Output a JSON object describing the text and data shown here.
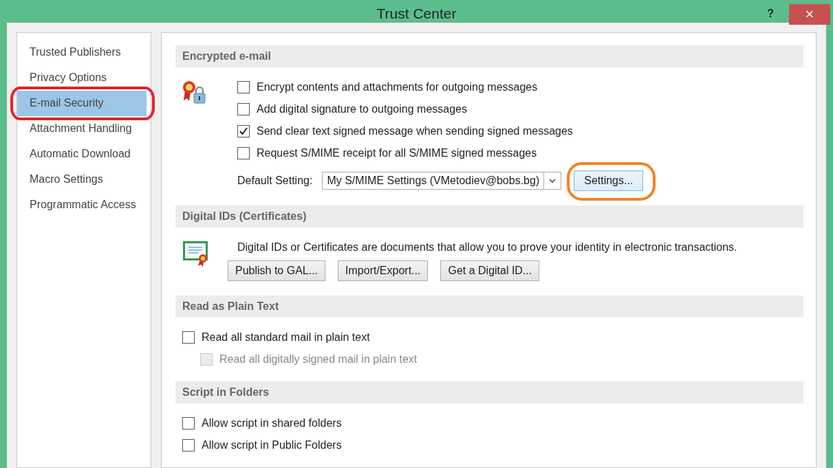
{
  "window": {
    "title": "Trust Center",
    "help": "?",
    "close": "×"
  },
  "sidebar": {
    "items": [
      {
        "label": "Trusted Publishers",
        "selected": false,
        "circled": false
      },
      {
        "label": "Privacy Options",
        "selected": false,
        "circled": false
      },
      {
        "label": "E-mail Security",
        "selected": true,
        "circled": true
      },
      {
        "label": "Attachment Handling",
        "selected": false,
        "circled": false
      },
      {
        "label": "Automatic Download",
        "selected": false,
        "circled": false
      },
      {
        "label": "Macro Settings",
        "selected": false,
        "circled": false
      },
      {
        "label": "Programmatic Access",
        "selected": false,
        "circled": false
      }
    ]
  },
  "sections": [
    {
      "title": "Encrypted e-mail",
      "options": [
        {
          "label": "Encrypt contents and attachments for outgoing messages",
          "checked": false,
          "disabled": false
        },
        {
          "label": "Add digital signature to outgoing messages",
          "checked": false,
          "disabled": false
        },
        {
          "label": "Send clear text signed message when sending signed messages",
          "checked": true,
          "disabled": false
        },
        {
          "label": "Request S/MIME receipt for all S/MIME signed messages",
          "checked": false,
          "disabled": false
        }
      ],
      "default_setting": {
        "label": "Default Setting:",
        "value": "My S/MIME Settings (VMetodiev@bobs.bg)",
        "button": "Settings...",
        "button_circled": true
      }
    },
    {
      "title": "Digital IDs (Certificates)",
      "description": "Digital IDs or Certificates are documents that allow you to prove your identity in electronic transactions.",
      "buttons": [
        "Publish to GAL...",
        "Import/Export...",
        "Get a Digital ID..."
      ]
    },
    {
      "title": "Read as Plain Text",
      "options": [
        {
          "label": "Read all standard mail in plain text",
          "checked": false,
          "disabled": false,
          "children": [
            {
              "label": "Read all digitally signed mail in plain text",
              "checked": false,
              "disabled": true
            }
          ]
        }
      ]
    },
    {
      "title": "Script in Folders",
      "options": [
        {
          "label": "Allow script in shared folders",
          "checked": false,
          "disabled": false
        },
        {
          "label": "Allow script in Public Folders",
          "checked": false,
          "disabled": false
        }
      ]
    }
  ]
}
